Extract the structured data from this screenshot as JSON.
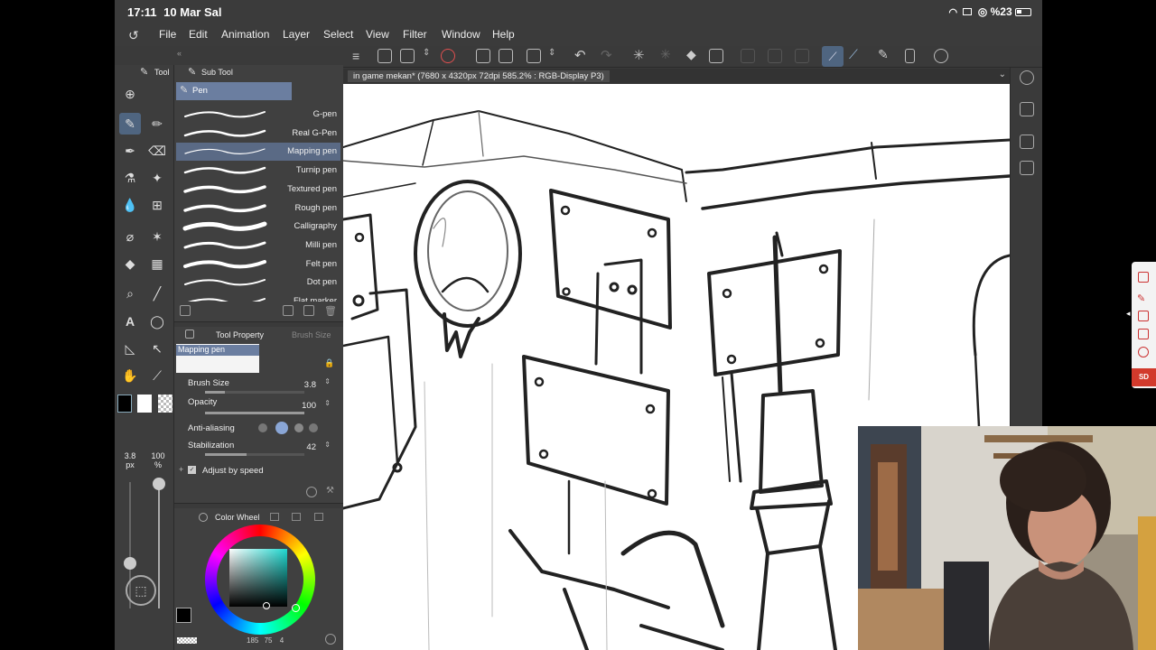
{
  "status_bar": {
    "time": "17:11",
    "date": "10 Mar Sal",
    "battery": "%23"
  },
  "menu": {
    "items": [
      "File",
      "Edit",
      "Animation",
      "Layer",
      "Select",
      "View",
      "Filter",
      "Window",
      "Help"
    ]
  },
  "document": {
    "tab_title": "in game mekan* (7680 x 4320px 72dpi 585.2% : RGB-Display P3)"
  },
  "tool_panel": {
    "tab_tool": "Tool",
    "tab_subtool": "Sub Tool",
    "brush_size_display": "3.8",
    "brush_size_unit": "px",
    "opacity_display": "100",
    "opacity_unit": "%",
    "tool_footer_label": "Tool"
  },
  "subtool": {
    "group": "Pen",
    "items": [
      {
        "label": "G-pen"
      },
      {
        "label": "Real G-Pen"
      },
      {
        "label": "Mapping pen",
        "selected": true
      },
      {
        "label": "Turnip pen"
      },
      {
        "label": "Textured pen"
      },
      {
        "label": "Rough pen"
      },
      {
        "label": "Calligraphy"
      },
      {
        "label": "Milli pen"
      },
      {
        "label": "Felt pen"
      },
      {
        "label": "Dot pen"
      },
      {
        "label": "Flat marker"
      }
    ]
  },
  "tool_property": {
    "tab_label": "Tool Property",
    "tab_brush": "Brush Size",
    "preset": "Mapping pen",
    "brush_size_label": "Brush Size",
    "brush_size": "3.8",
    "opacity_label": "Opacity",
    "opacity": "100",
    "antialias_label": "Anti-aliasing",
    "stabilization_label": "Stabilization",
    "stabilization": "42",
    "adjust_label": "Adjust by speed"
  },
  "color_wheel": {
    "title": "Color Wheel",
    "hsv_readout": "185",
    "s_readout": "75",
    "v_readout": "4",
    "main_color": "#000000",
    "sub_color": "#ffffff"
  },
  "right_floater": {
    "badge": "SD"
  }
}
